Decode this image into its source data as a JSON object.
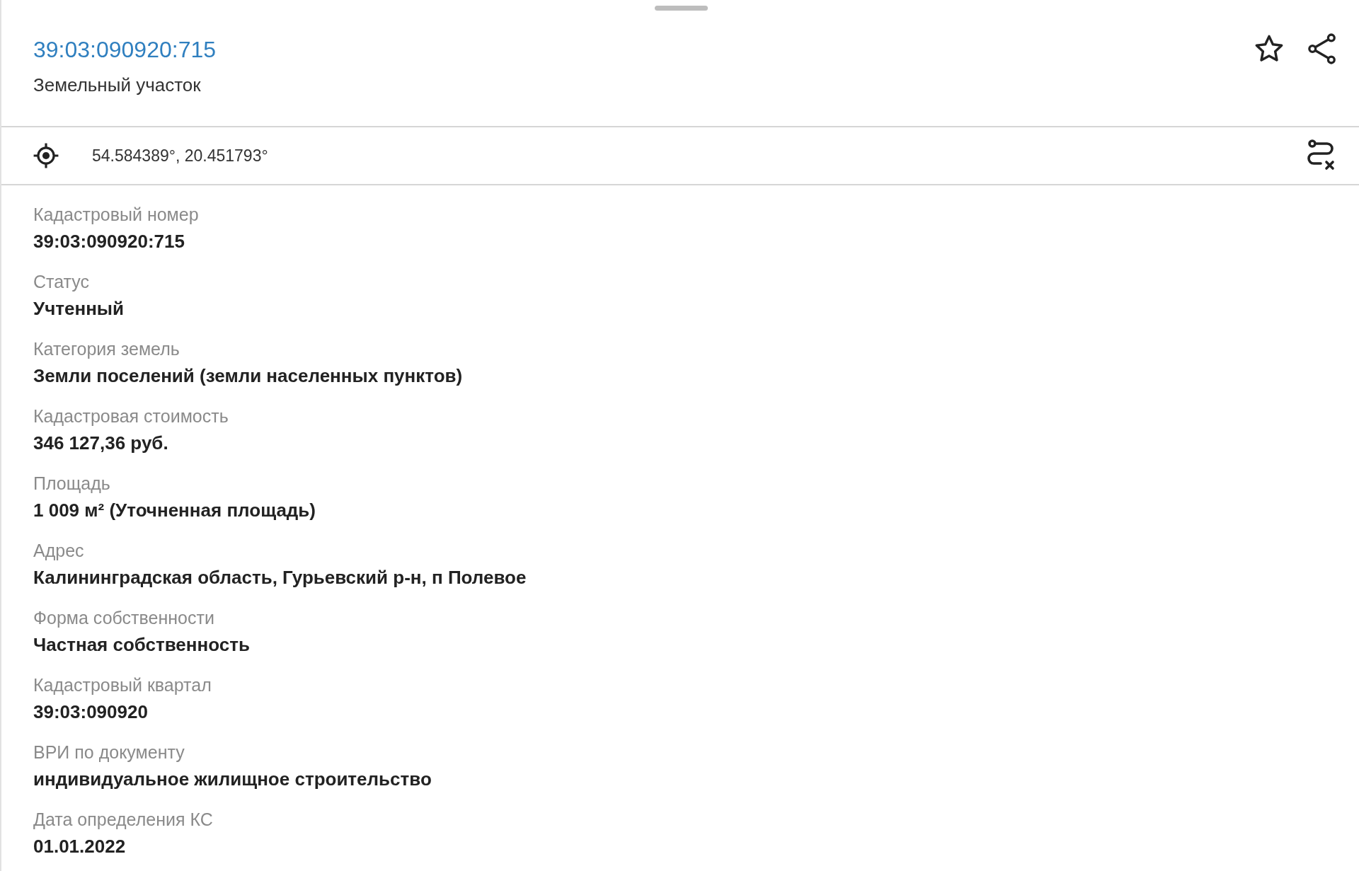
{
  "header": {
    "title": "39:03:090920:715",
    "subtitle": "Земельный участок",
    "favorite": false
  },
  "location": {
    "coordinates": "54.584389°, 20.451793°"
  },
  "fields": [
    {
      "label": "Кадастровый номер",
      "value": "39:03:090920:715"
    },
    {
      "label": "Статус",
      "value": "Учтенный"
    },
    {
      "label": "Категория земель",
      "value": "Земли поселений (земли населенных пунктов)"
    },
    {
      "label": "Кадастровая стоимость",
      "value": "346 127,36 руб."
    },
    {
      "label": "Площадь",
      "value": "1 009 м² (Уточненная площадь)"
    },
    {
      "label": "Адрес",
      "value": "Калининградская область, Гурьевский р-н, п Полевое"
    },
    {
      "label": "Форма собственности",
      "value": "Частная собственность"
    },
    {
      "label": "Кадастровый квартал",
      "value": "39:03:090920"
    },
    {
      "label": "ВРИ по документу",
      "value": "индивидуальное жилищное строительство"
    },
    {
      "label": "Дата определения КС",
      "value": "01.01.2022"
    }
  ]
}
